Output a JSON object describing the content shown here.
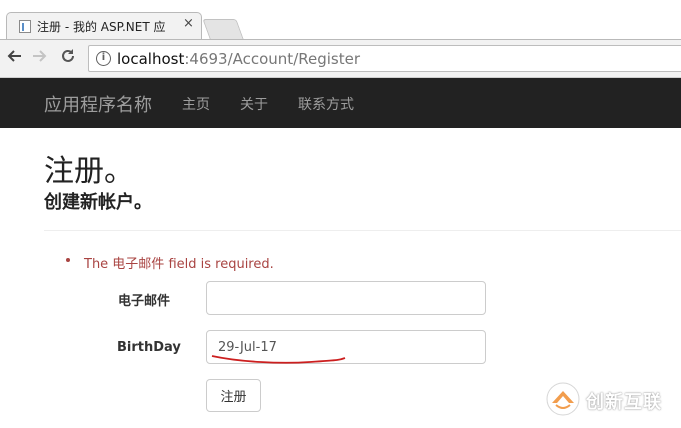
{
  "browser": {
    "tab": {
      "title": "注册 - 我的 ASP.NET 应",
      "close": "×"
    },
    "address": {
      "host": "localhost",
      "path": ":4693/Account/Register"
    },
    "icons": {
      "back": "arrow-left-icon",
      "forward": "arrow-right-icon",
      "reload": "reload-icon",
      "info": "info-icon"
    }
  },
  "navbar": {
    "brand": "应用程序名称",
    "links": [
      "主页",
      "关于",
      "联系方式"
    ],
    "background": "#222222"
  },
  "page": {
    "title": "注册。",
    "subtitle": "创建新帐户。"
  },
  "validation": {
    "errors": [
      "The 电子邮件 field is required."
    ],
    "color": "#a94442"
  },
  "form": {
    "email": {
      "label": "电子邮件",
      "value": ""
    },
    "birthday": {
      "label": "BirthDay",
      "value": "29-Jul-17"
    },
    "submit_label": "注册"
  },
  "annotation": {
    "color": "#cc1f1f"
  },
  "watermark": {
    "text": "创新互联",
    "color": "#f08c2e"
  }
}
